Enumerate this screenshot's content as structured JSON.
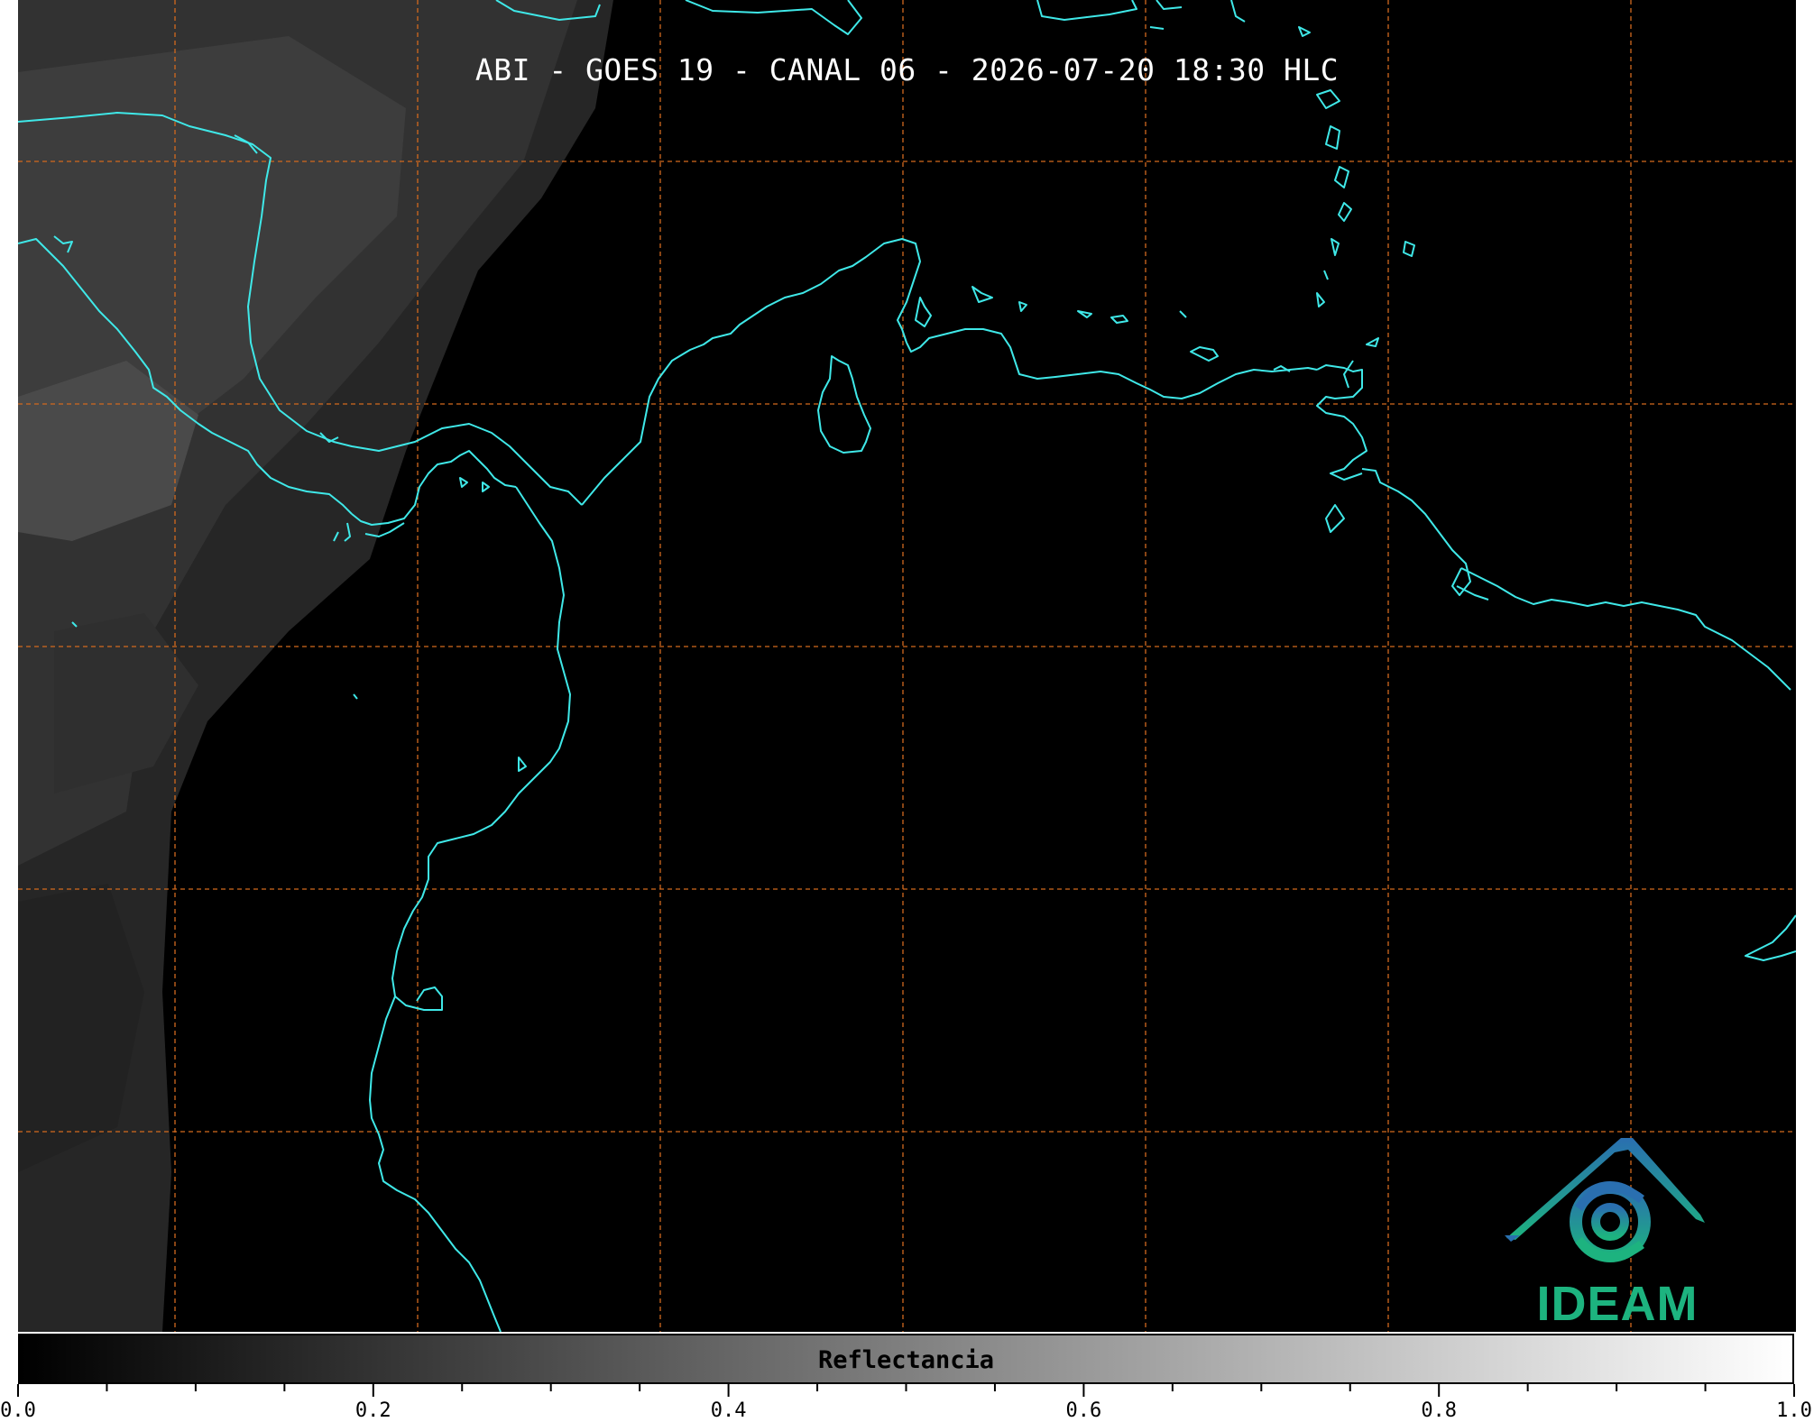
{
  "map": {
    "title": "ABI - GOES 19 - CANAL 06 - 2026-07-20 18:30 HLC",
    "coastline_color": "#3fe8e8",
    "grid_color": "#d2691e",
    "background_color": "#000000",
    "graticule_style": "dashed",
    "logo_text": "IDEAM",
    "logo_color_top": "#2a6fb0",
    "logo_color_bottom": "#1db37f"
  },
  "colorbar": {
    "label": "Reflectancia",
    "colormap": "grayscale black-to-white",
    "range": [
      0.0,
      1.0
    ],
    "tick_labels": [
      "0.0",
      "0.2",
      "0.4",
      "0.6",
      "0.8",
      "1.0"
    ]
  }
}
